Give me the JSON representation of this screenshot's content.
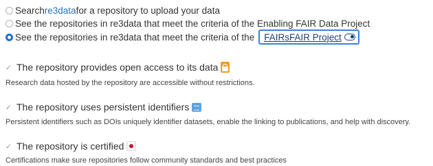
{
  "options": [
    {
      "prefix": "Search ",
      "link": "re3data",
      "suffix": " for a repository to upload your data",
      "selected": false
    },
    {
      "text": "See the repositories in re3data that meet the criteria of the Enabling FAIR Data Project",
      "selected": false
    },
    {
      "text": "See the repositories in re3data that meet the criteria of the",
      "link": "FAIRsFAIR Project",
      "selected": true
    }
  ],
  "criteria": [
    {
      "title": "The repository provides open access to its data",
      "description": "Research data hosted by the repository are accessible without restrictions.",
      "badge_icon": "open-access-lock-icon"
    },
    {
      "title": "The repository uses persistent identifiers",
      "description": "Persistent identifiers such as DOIs uniquely identifier datasets, enable the linking to publications, and help with discovery.",
      "badge_icon": "persistent-identifier-icon"
    },
    {
      "title": "The repository is certified",
      "description": "Certifications make sure repositories follow community standards and best practices",
      "badge_icon": "certification-seal-icon"
    }
  ],
  "icons": {
    "check": "checkmark-icon",
    "toggle": "toggle-icon"
  },
  "colors": {
    "link": "#2a6eb6",
    "selected_radio": "#1f6fd1",
    "focus_outline": "#3d7fe0",
    "open_access_badge": "#f39a2a",
    "pid_badge": "#5fa2de",
    "cert_badge_dot": "#c0182a"
  }
}
